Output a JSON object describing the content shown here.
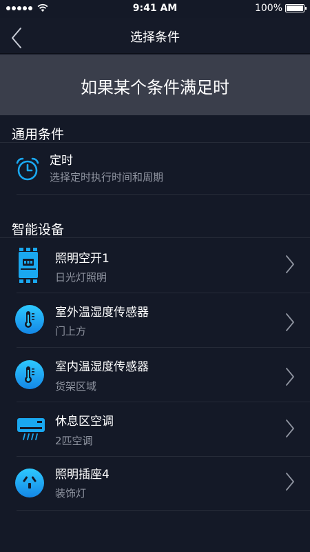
{
  "status_bar": {
    "time": "9:41 AM",
    "battery": "100%"
  },
  "nav": {
    "title": "选择条件",
    "back_icon": "chevron-left-icon"
  },
  "banner": {
    "text": "如果某个条件满足时"
  },
  "general": {
    "section_title": "通用条件",
    "items": [
      {
        "title": "定时",
        "subtitle": "选择定时执行时间和周期",
        "icon": "alarm-clock-icon"
      }
    ]
  },
  "devices": {
    "section_title": "智能设备",
    "items": [
      {
        "title": "照明空开1",
        "subtitle": "日光灯照明",
        "icon": "circuit-breaker-icon"
      },
      {
        "title": "室外温湿度传感器",
        "subtitle": "门上方",
        "icon": "thermometer-icon"
      },
      {
        "title": "室内温湿度传感器",
        "subtitle": "货架区域",
        "icon": "thermometer-icon"
      },
      {
        "title": "休息区空调",
        "subtitle": "2匹空调",
        "icon": "air-conditioner-icon"
      },
      {
        "title": "照明插座4",
        "subtitle": "装饰灯",
        "icon": "socket-icon"
      }
    ]
  },
  "colors": {
    "background": "#141927",
    "banner": "#3a3e4b",
    "accent": "#1aa8f0",
    "subtitle": "#8f94a0"
  }
}
